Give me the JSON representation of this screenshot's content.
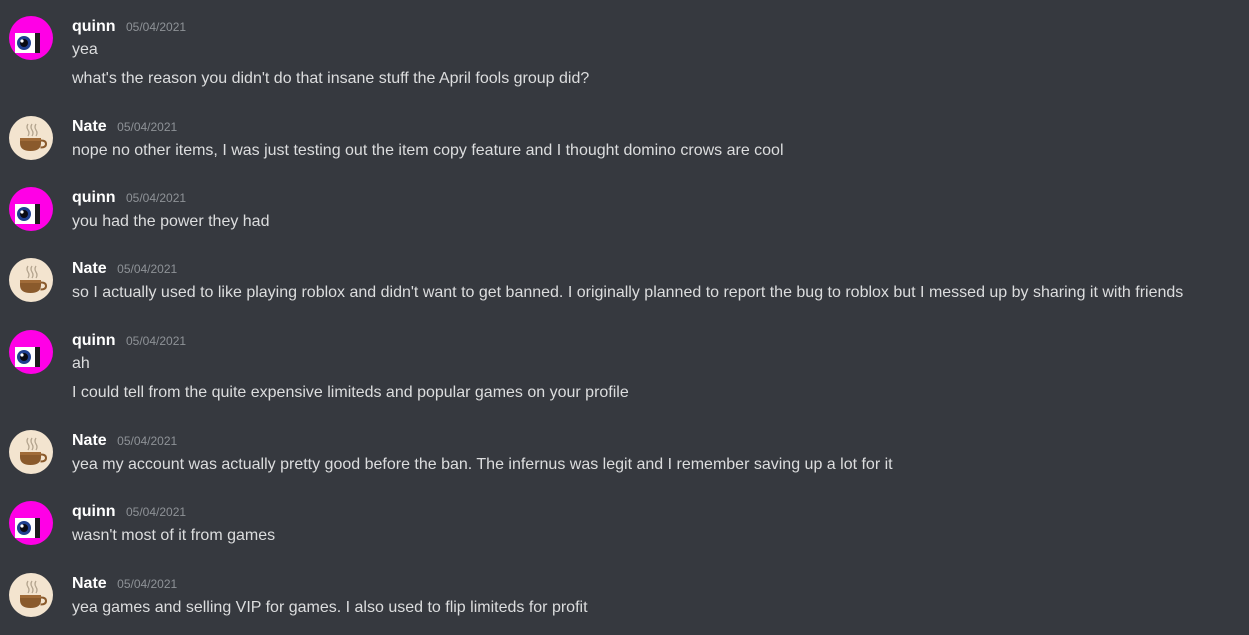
{
  "messages": [
    {
      "author": "quinn",
      "timestamp": "05/04/2021",
      "avatar_icon": "quinn-eye-avatar-icon",
      "lines": [
        "yea",
        "what's the reason you didn't do that insane stuff the April fools group did?"
      ]
    },
    {
      "author": "Nate",
      "timestamp": "05/04/2021",
      "avatar_icon": "coffee-cup-avatar-icon",
      "lines": [
        "nope no other items, I was just testing out the item copy feature and I thought domino crows are cool"
      ]
    },
    {
      "author": "quinn",
      "timestamp": "05/04/2021",
      "avatar_icon": "quinn-eye-avatar-icon",
      "lines": [
        "you had the power they had"
      ]
    },
    {
      "author": "Nate",
      "timestamp": "05/04/2021",
      "avatar_icon": "coffee-cup-avatar-icon",
      "lines": [
        "so I actually used to like playing roblox and didn't want to get banned. I originally planned to report the bug to roblox but I messed up by sharing it with friends"
      ]
    },
    {
      "author": "quinn",
      "timestamp": "05/04/2021",
      "avatar_icon": "quinn-eye-avatar-icon",
      "lines": [
        "ah",
        "I could tell from the quite expensive limiteds and popular games on your profile"
      ]
    },
    {
      "author": "Nate",
      "timestamp": "05/04/2021",
      "avatar_icon": "coffee-cup-avatar-icon",
      "lines": [
        "yea my account was actually pretty good before the ban. The infernus was legit and I remember saving up a lot for it"
      ]
    },
    {
      "author": "quinn",
      "timestamp": "05/04/2021",
      "avatar_icon": "quinn-eye-avatar-icon",
      "lines": [
        "wasn't most of it from games"
      ]
    },
    {
      "author": "Nate",
      "timestamp": "05/04/2021",
      "avatar_icon": "coffee-cup-avatar-icon",
      "lines": [
        "yea games and selling VIP for games. I also used to flip limiteds for profit"
      ]
    }
  ],
  "colors": {
    "background": "#36393f",
    "username": "#ffffff",
    "timestamp": "#8e9297",
    "message_text": "#dcddde",
    "quinn_avatar": "#ff00e6",
    "nate_avatar": "#f3e4cf"
  }
}
